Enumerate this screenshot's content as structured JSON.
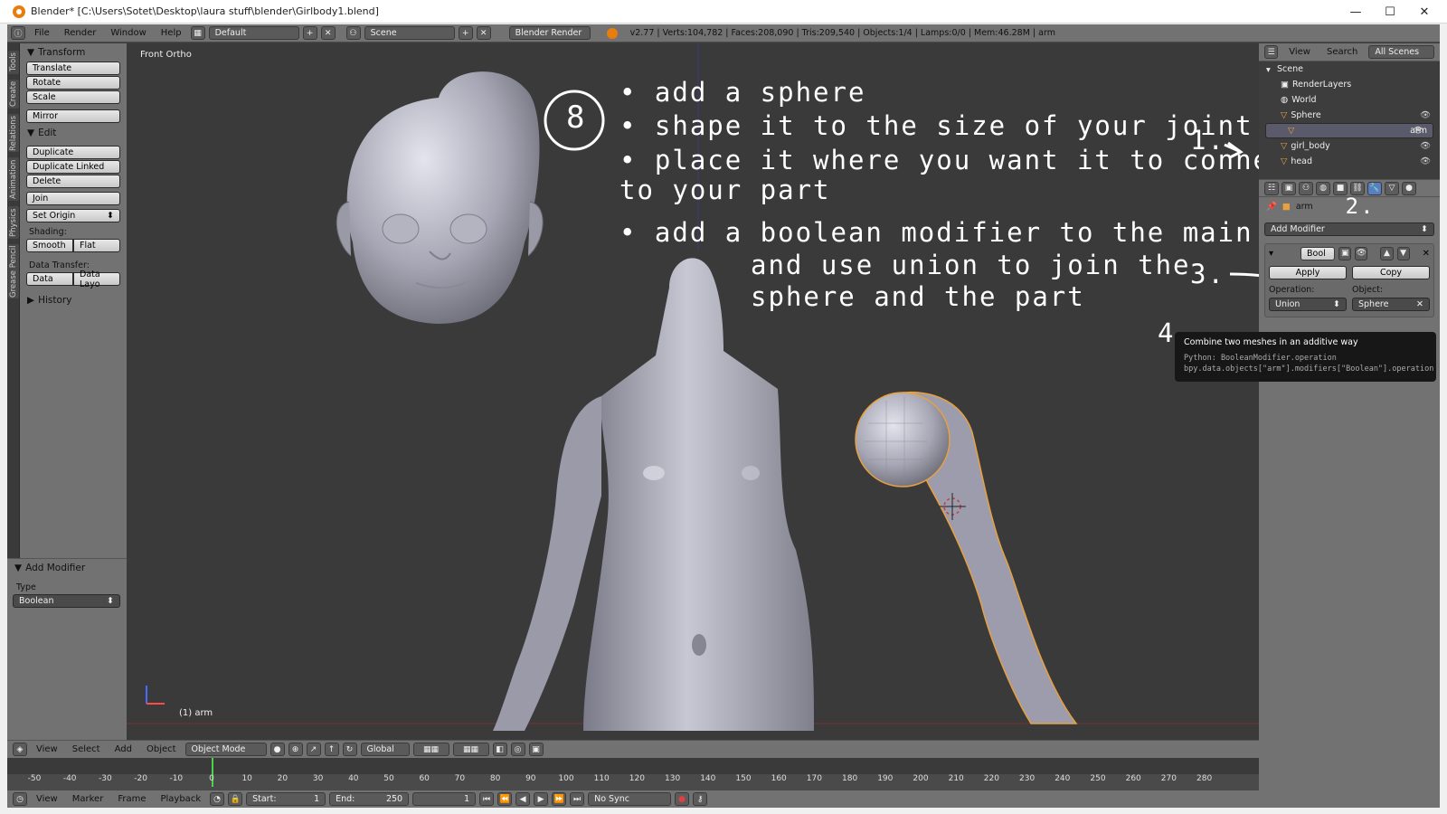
{
  "window": {
    "title": "Blender* [C:\\Users\\Sotet\\Desktop\\laura stuff\\blender\\Girlbody1.blend]",
    "minimize": "—",
    "maximize": "☐",
    "close": "✕"
  },
  "topbar": {
    "menus": [
      "File",
      "Render",
      "Window",
      "Help"
    ],
    "layout": "Default",
    "scene": "Scene",
    "engine": "Blender Render",
    "stats": "v2.77 | Verts:104,782 | Faces:208,090 | Tris:209,540 | Objects:1/4 | Lamps:0/0 | Mem:46.28M | arm"
  },
  "tabs": [
    "Tools",
    "Create",
    "Relations",
    "Animation",
    "Physics",
    "Grease Pencil"
  ],
  "tools": {
    "transform_header": "Transform",
    "translate": "Translate",
    "rotate": "Rotate",
    "scale": "Scale",
    "mirror": "Mirror",
    "edit_header": "Edit",
    "duplicate": "Duplicate",
    "duplicate_linked": "Duplicate Linked",
    "delete": "Delete",
    "join": "Join",
    "set_origin": "Set Origin",
    "shading_label": "Shading:",
    "smooth": "Smooth",
    "flat": "Flat",
    "data_transfer_label": "Data Transfer:",
    "data": "Data",
    "data_layout": "Data Layo",
    "history_header": "History",
    "add_modifier_header": "Add Modifier",
    "type_label": "Type",
    "type_value": "Boolean"
  },
  "viewport": {
    "view_name": "Front Ortho",
    "object_label": "(1) arm",
    "notes": {
      "num": "8",
      "l1": "• add  a  sphere",
      "l2": "• shape  it  to  the  size  of  your  joint",
      "l3": "• place it where  you  want  it  to  connect",
      "l4": "  to  your  part",
      "l5": "• add  a  boolean  modifier  to  the  main  part",
      "l6": "and use  union  to  join  the",
      "l7": "sphere  and  the  part",
      "s1": "1.",
      "s2": "2.",
      "s3": "3.",
      "s4": "4."
    }
  },
  "vheader": {
    "menus": [
      "View",
      "Select",
      "Add",
      "Object"
    ],
    "mode": "Object Mode",
    "orientation": "Global"
  },
  "timeline": {
    "ticks": [
      "-50",
      "-40",
      "-30",
      "-20",
      "-10",
      "0",
      "10",
      "20",
      "30",
      "40",
      "50",
      "60",
      "70",
      "80",
      "90",
      "100",
      "110",
      "120",
      "130",
      "140",
      "150",
      "160",
      "170",
      "180",
      "190",
      "200",
      "210",
      "220",
      "230",
      "240",
      "250",
      "260",
      "270",
      "280"
    ],
    "current_frame_value": 0
  },
  "tlbar": {
    "menus": [
      "View",
      "Marker",
      "Frame",
      "Playback"
    ],
    "start_label": "Start:",
    "start": "1",
    "end_label": "End:",
    "end": "250",
    "current": "1",
    "sync": "No Sync"
  },
  "outliner": {
    "menus": [
      "View",
      "Search"
    ],
    "filter": "All Scenes",
    "rows": [
      "Scene",
      "RenderLayers",
      "World",
      "Sphere",
      "arm",
      "girl_body",
      "head"
    ]
  },
  "properties": {
    "object_name": "arm",
    "add_modifier": "Add Modifier",
    "modifier_name": "Bool",
    "apply": "Apply",
    "copy": "Copy",
    "operation_label": "Operation:",
    "operation_value": "Union",
    "object_label": "Object:",
    "object_value": "Sphere"
  },
  "tooltip": {
    "desc": "Combine two meshes in an additive way",
    "python1": "Python: BooleanModifier.operation",
    "python2": "bpy.data.objects[\"arm\"].modifiers[\"Boolean\"].operation"
  },
  "colors": {
    "blender_orange": "#e87d0d",
    "selection_outline": "#e8a040",
    "playhead": "#4cd24c"
  }
}
